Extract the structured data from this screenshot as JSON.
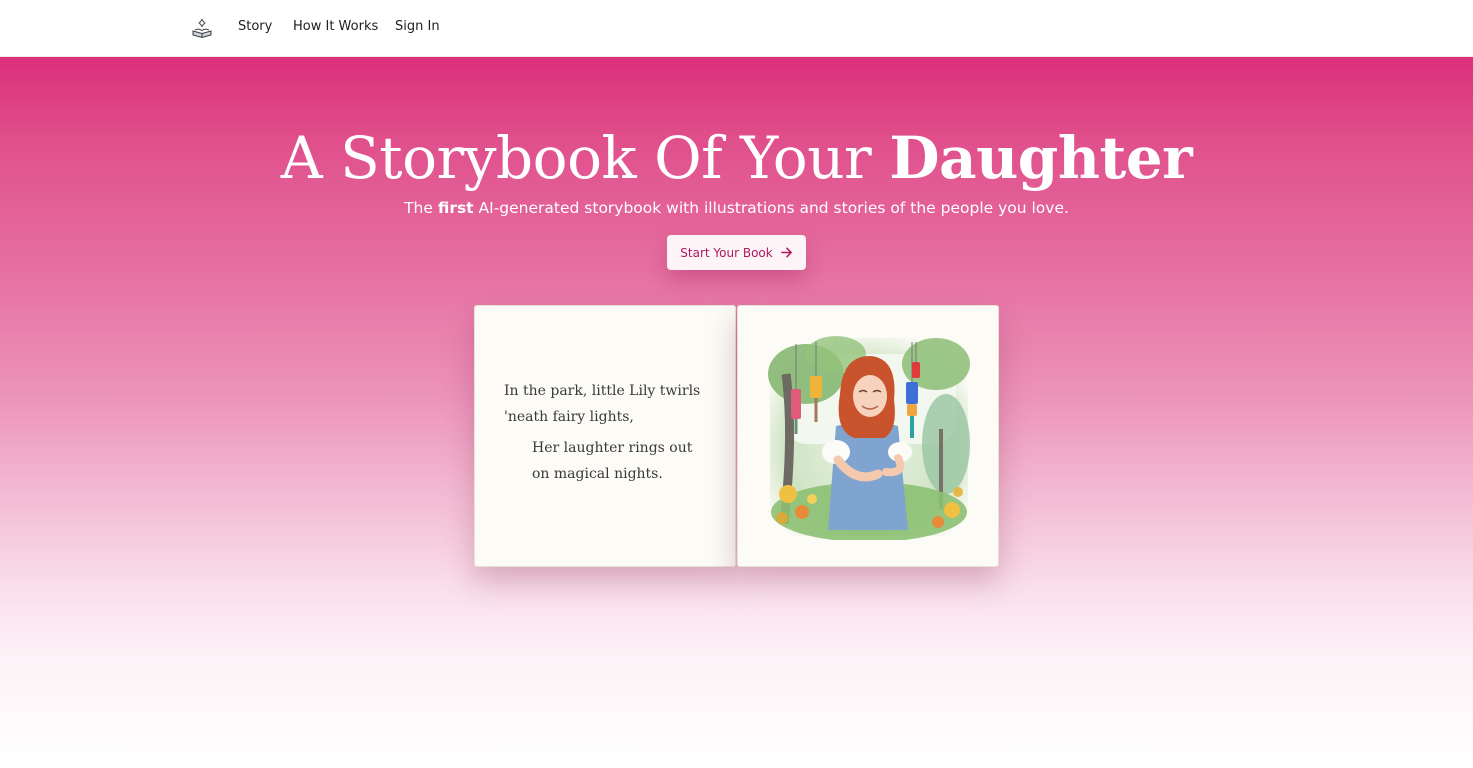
{
  "nav": {
    "logo_icon": "book-lamp-icon",
    "links": [
      "Story",
      "How It Works",
      "Sign In"
    ]
  },
  "hero": {
    "title_light": "A Storybook Of Your ",
    "title_bold": "Daughter",
    "subtitle_prefix": "The ",
    "subtitle_bold": "first",
    "subtitle_suffix": " AI-generated storybook with illustrations and stories of the people you love.",
    "cta_label": "Start Your Book",
    "cta_icon": "arrow-right-icon"
  },
  "book": {
    "poem_line_1": "In the park, little Lily twirls 'neath fairy lights,",
    "poem_line_2": "Her laughter rings out on magical nights.",
    "illustration": "girl-with-wind-chimes-illustration"
  },
  "colors": {
    "brand_pink": "#db2f7a",
    "cta_text": "#b0195e",
    "page_paper": "#fcfbf6"
  }
}
